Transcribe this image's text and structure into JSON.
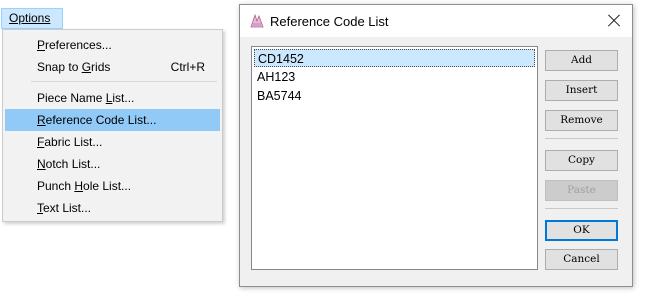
{
  "menubar": {
    "options": "Options"
  },
  "menu": {
    "preferences": {
      "label_u": "P",
      "label_rest": "references..."
    },
    "snap_to_grids": {
      "label_pre": "Snap to ",
      "label_u": "G",
      "label_rest": "rids",
      "shortcut": "Ctrl+R"
    },
    "piece_name_list": {
      "label_pre": "Piece Name ",
      "label_u": "L",
      "label_rest": "ist..."
    },
    "reference_code_list": {
      "label_u": "R",
      "label_rest": "eference Code List..."
    },
    "fabric_list": {
      "label_u": "F",
      "label_rest": "abric List..."
    },
    "notch_list": {
      "label_u": "N",
      "label_rest": "otch List..."
    },
    "punch_hole_list": {
      "label_pre": "Punch ",
      "label_u": "H",
      "label_rest": "ole List..."
    },
    "text_list": {
      "label_u": "T",
      "label_rest": "ext List..."
    }
  },
  "dialog": {
    "title": "Reference Code List",
    "items": [
      "CD1452",
      "AH123",
      "BA5744"
    ],
    "buttons": {
      "add": "Add",
      "insert": "Insert",
      "remove": "Remove",
      "copy": "Copy",
      "paste": "Paste",
      "ok": "OK",
      "cancel": "Cancel"
    }
  },
  "colors": {
    "menu_highlight": "#91c9f7",
    "menubar_active": "#cce8ff",
    "default_button_border": "#0078d7"
  }
}
